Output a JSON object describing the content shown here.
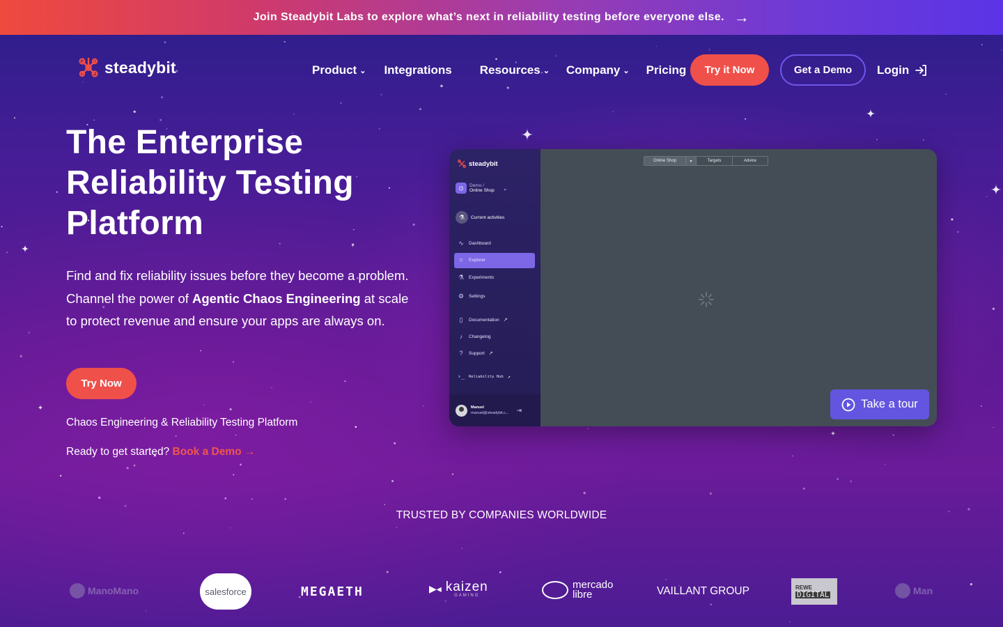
{
  "banner": {
    "text": "Join Steadybit Labs to explore what’s next in reliability testing before everyone else.",
    "arrow": "→"
  },
  "nav": {
    "logo_text": "steadybit",
    "items": [
      {
        "label": "Product",
        "has_dropdown": true
      },
      {
        "label": "Integrations",
        "has_dropdown": false
      },
      {
        "label": "Resources",
        "has_dropdown": true
      },
      {
        "label": "Company",
        "has_dropdown": true
      },
      {
        "label": "Pricing",
        "has_dropdown": false
      }
    ],
    "try_label": "Try it Now",
    "demo_label": "Get a Demo",
    "login_label": "Login"
  },
  "hero": {
    "title_lines": [
      "The Enterprise",
      "Reliability Testing",
      "Platform"
    ],
    "sub_before": "Find and fix reliability issues before they become a problem. Channel the power of ",
    "sub_bold": "Agentic Chaos Engineering",
    "sub_after": " at scale to protect revenue and ensure your apps are always on.",
    "cta_label": "Try Now",
    "tagline": "Chaos Engineering & Reliability Testing Platform",
    "ready_text": "Ready to get started?",
    "ready_link": "Book a Demo →"
  },
  "app_preview": {
    "logo_text": "steadybit",
    "env_top": "Demo /",
    "env_name": "Online Shop",
    "current": "Current activities",
    "menu": [
      {
        "label": "Dashboard",
        "icon": "pulse-icon"
      },
      {
        "label": "Explorer",
        "icon": "explorer-icon",
        "active": true
      },
      {
        "label": "Experiments",
        "icon": "flask-icon"
      },
      {
        "label": "Settings",
        "icon": "gear-icon"
      },
      {
        "label": "Documentation",
        "icon": "book-icon",
        "external": true
      },
      {
        "label": "Changelog",
        "icon": "bell-icon"
      },
      {
        "label": "Support",
        "icon": "help-icon",
        "external": true
      },
      {
        "label": "Reliability Hub",
        "icon": "terminal-icon",
        "external": true
      }
    ],
    "user_name": "Manuel",
    "user_email": "manuel@steadybit.c...",
    "tabs": [
      "Online Shop",
      "▾",
      "Targets",
      "Advice"
    ],
    "tour_label": "Take a tour",
    "colors": {
      "sidebar": "#2a2163",
      "canvas": "#444d55",
      "active": "#7d67e6",
      "tour": "#6355e0"
    }
  },
  "trusted": {
    "heading": "TRUSTED BY COMPANIES WORLDWIDE",
    "logos": [
      "ManoMano",
      "salesforce",
      "MEGAETH",
      "kaizen",
      "GAMING",
      "mercado",
      "libre",
      "VAILLANT GROUP",
      "REWE",
      "DIGITAL",
      "ManoMano"
    ]
  },
  "colors": {
    "accent": "#f0504a",
    "outline": "#6d56e8",
    "link": "#f0564e"
  }
}
